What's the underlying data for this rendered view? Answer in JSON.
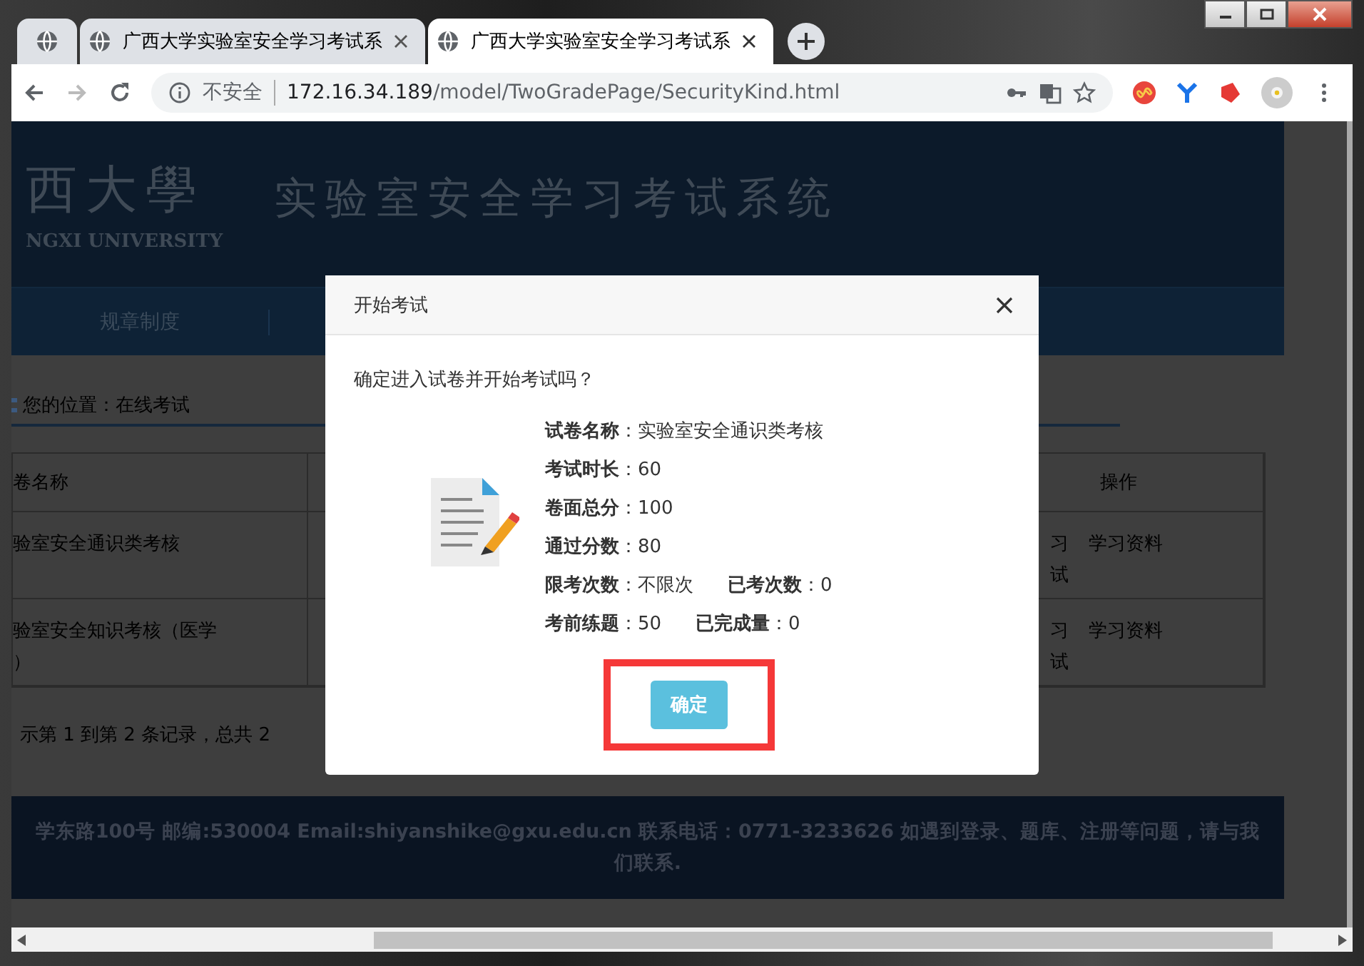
{
  "browser": {
    "tabs": [
      {
        "kind": "pinned",
        "selected": false
      },
      {
        "kind": "page",
        "title": "广西大学实验室安全学习考试系",
        "selected": false
      },
      {
        "kind": "page",
        "title": "广西大学实验室安全学习考试系",
        "selected": true
      }
    ],
    "address": {
      "security": "不安全",
      "host": "172.16.34.189",
      "path": "/model/TwoGradePage/SecurityKind.html"
    }
  },
  "page": {
    "banner": {
      "logo": "西大學",
      "logo_en": "NGXI UNIVERSITY",
      "title": "实验室安全学习考试系统"
    },
    "nav": [
      "规章制度"
    ],
    "breadcrumb": "您的位置：在线考试",
    "table": {
      "columns": [
        "卷名称",
        "操作"
      ],
      "rows": [
        {
          "name_lines": [
            "验室安全通识类考核"
          ],
          "actions": [
            [
              "习",
              "学习资料"
            ],
            [
              "试"
            ]
          ]
        },
        {
          "name_lines": [
            "验室安全知识考核（医学",
            "）"
          ],
          "actions": [
            [
              "习",
              "学习资料"
            ],
            [
              "试"
            ]
          ]
        }
      ]
    },
    "pagination": "示第 1 到第 2 条记录，总共 2",
    "footer": [
      "学东路100号 邮编:530004 Email:shiyanshike@gxu.edu.cn 联系电话：0771-3233626 如遇到登录、题库、注册等问题，请与我",
      "们联系."
    ]
  },
  "modal": {
    "title": "开始考试",
    "question": "确定进入试卷并开始考试吗？",
    "fields": [
      [
        "**试卷名称**：实验室安全通识类考核"
      ],
      [
        "**考试时长**：60"
      ],
      [
        "**卷面总分**：100"
      ],
      [
        "**通过分数**：80"
      ],
      [
        "**限考次数**：不限次",
        "**已考次数**：0"
      ],
      [
        "**考前练题**：50",
        "**已完成量**：0"
      ]
    ],
    "button": "确定"
  }
}
